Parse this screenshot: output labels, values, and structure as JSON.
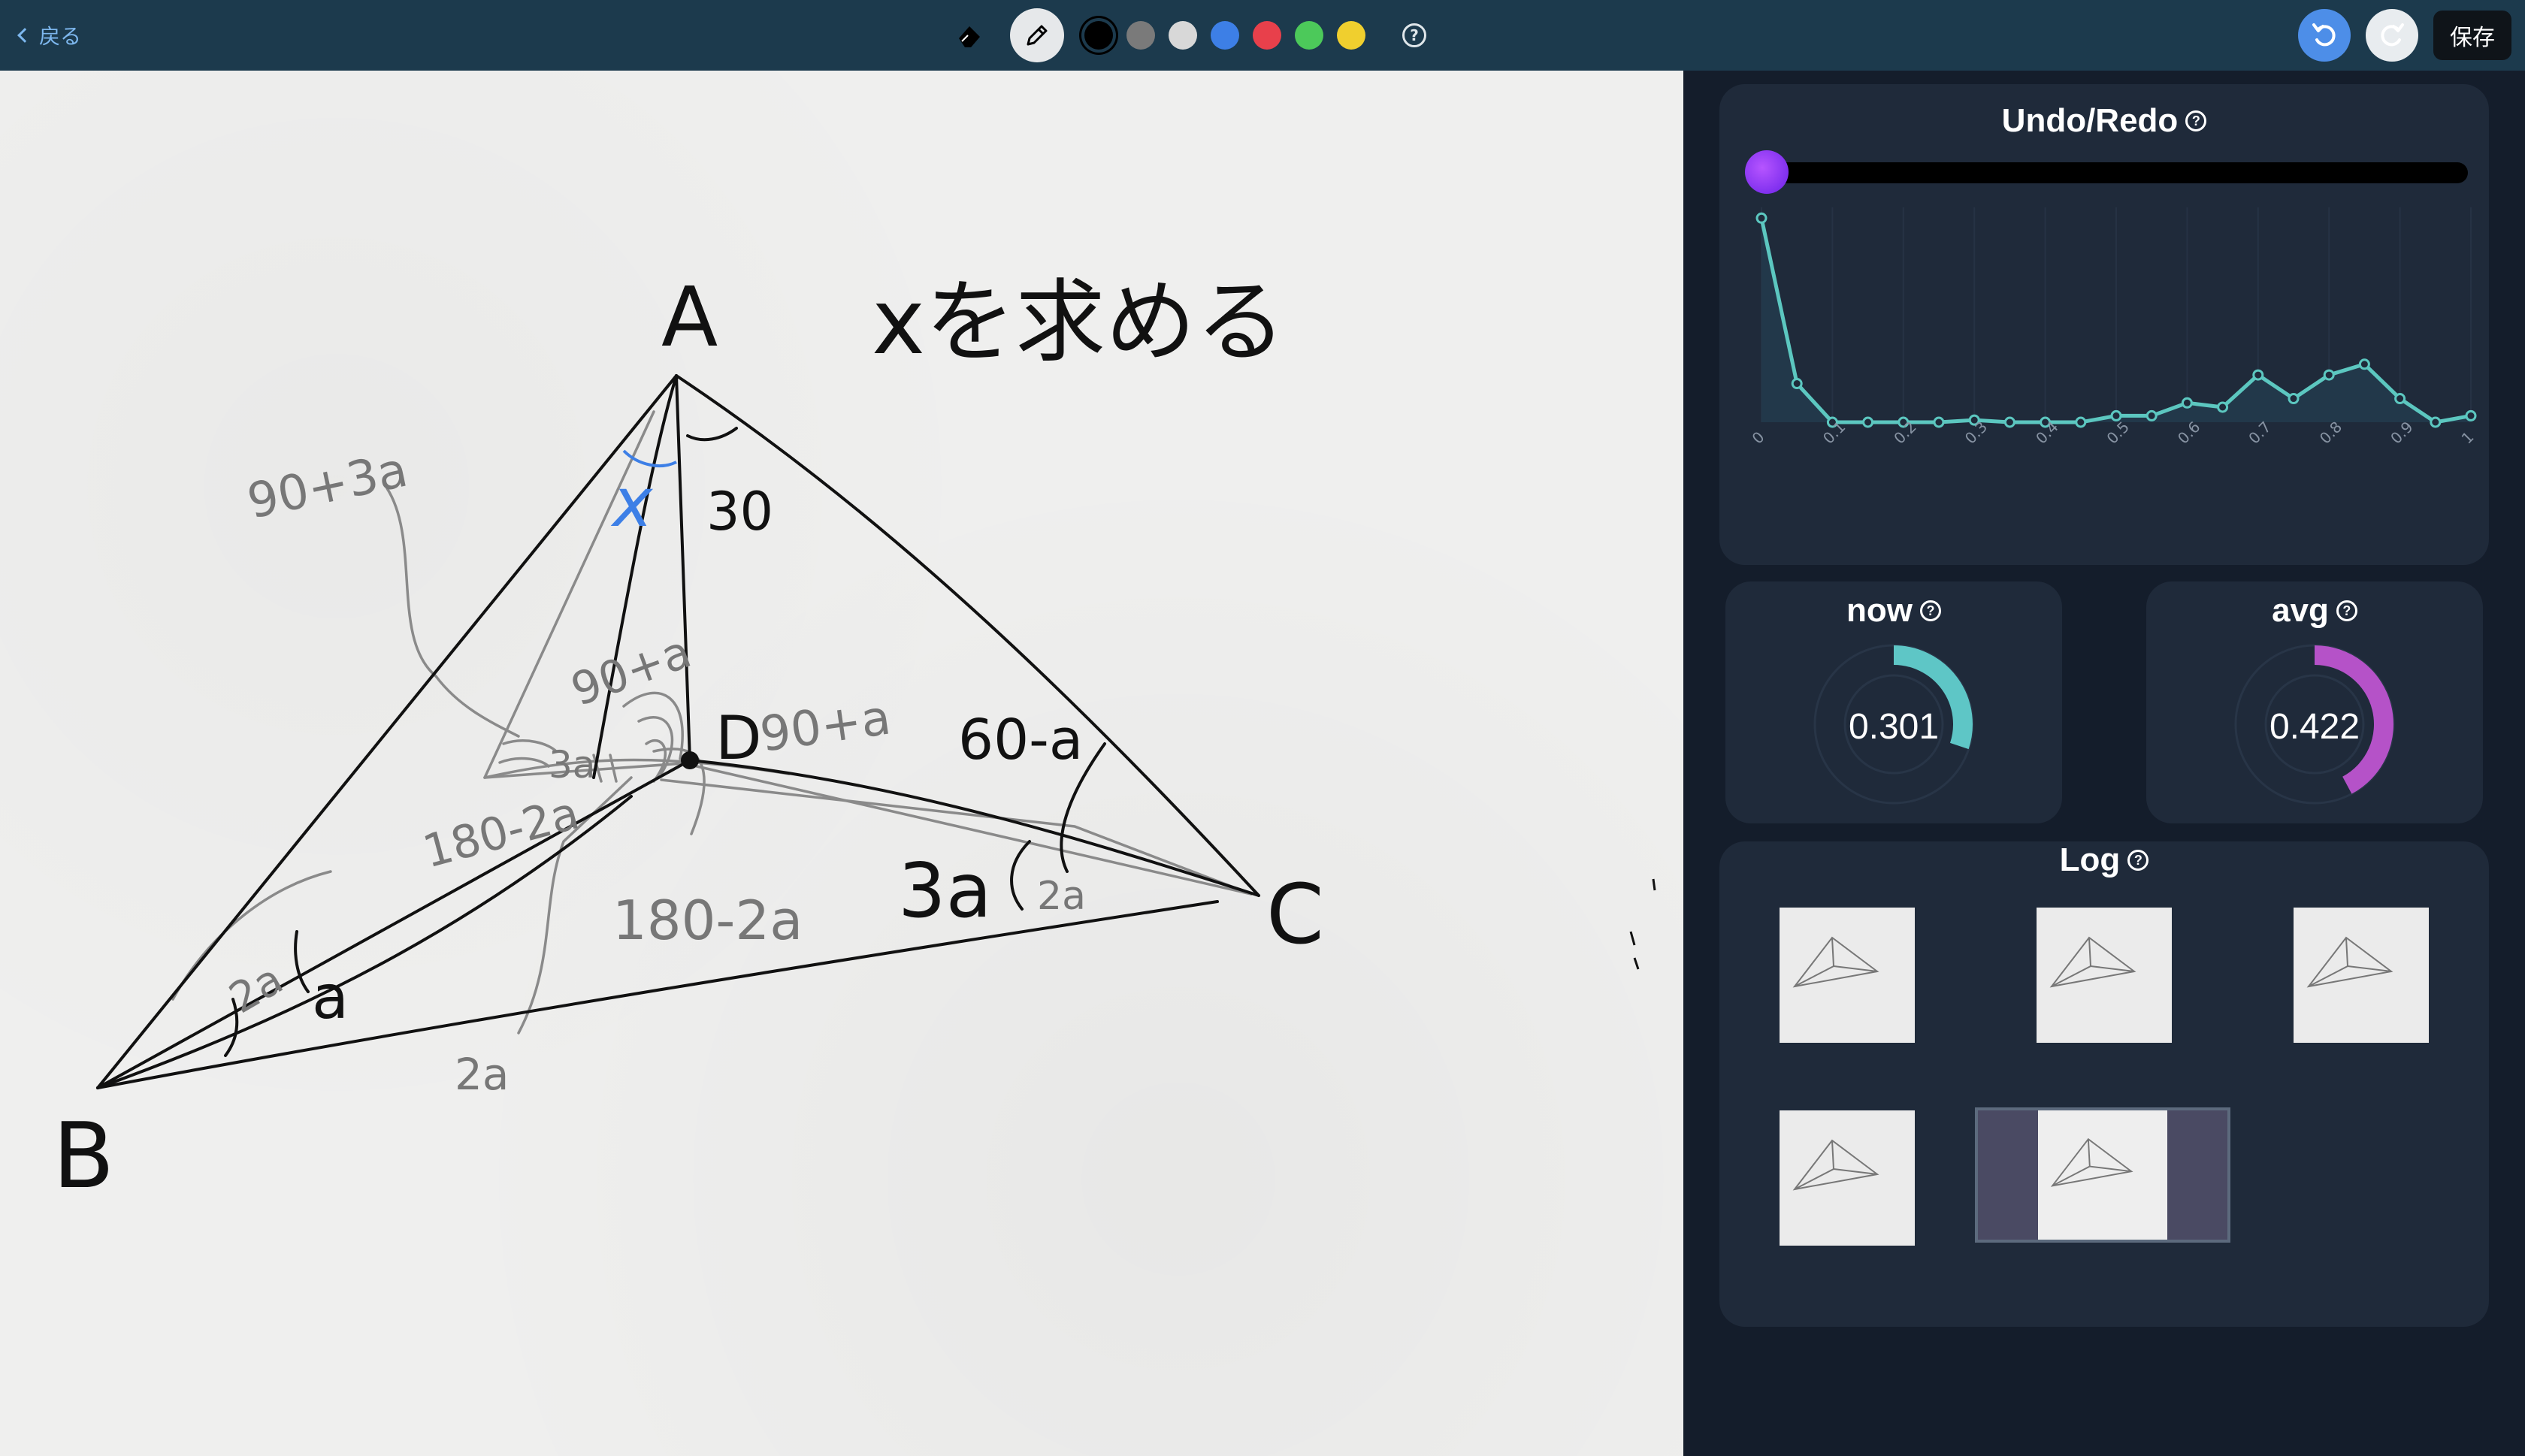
{
  "topbar": {
    "back_label": "戻る",
    "save_label": "保存",
    "colors": [
      "#000000",
      "#7a7a7a",
      "#d8d8d8",
      "#3d7fe6",
      "#e8404b",
      "#4cc95a",
      "#f0cf2e"
    ],
    "selected_color": "#000000"
  },
  "canvas": {
    "text": {
      "vertex_a": "A",
      "vertex_b": "B",
      "vertex_c": "C",
      "vertex_d": "D",
      "heading": "xを求める",
      "x_label": "x",
      "label_30": "30",
      "label_90_3a": "90+3a",
      "label_90_a_top": "90+a",
      "label_90_a_right": "90+a",
      "label_60_a": "60-a",
      "label_3a": "3a",
      "label_2a_c": "2a",
      "label_3a_small": "3a",
      "label_180_2a_left": "180-2a",
      "label_180_2a_bottom": "180-2a",
      "label_2a_b": "2a",
      "label_a_b": "a",
      "label_2a_bottom": "2a"
    }
  },
  "undo_redo": {
    "title": "Undo/Redo",
    "chart_data": {
      "type": "area",
      "x": [
        0,
        0.05,
        0.1,
        0.15,
        0.2,
        0.25,
        0.3,
        0.35,
        0.4,
        0.45,
        0.5,
        0.55,
        0.6,
        0.65,
        0.7,
        0.75,
        0.8,
        0.85,
        0.9,
        0.95,
        1.0
      ],
      "values": [
        0.95,
        0.18,
        0.0,
        0.0,
        0.0,
        0.0,
        0.01,
        0.0,
        0.0,
        0.0,
        0.03,
        0.03,
        0.09,
        0.07,
        0.22,
        0.11,
        0.22,
        0.27,
        0.11,
        0.0,
        0.03
      ],
      "x_ticks": [
        "0",
        "0.1",
        "0.2",
        "0.3",
        "0.4",
        "0.5",
        "0.6",
        "0.7",
        "0.8",
        "0.9",
        "1"
      ],
      "ylim": [
        0,
        1
      ],
      "line_color": "#5cc7c0"
    },
    "slider_position": 0
  },
  "now": {
    "title": "now",
    "value": "0.301",
    "fraction": 0.301,
    "color": "#5ec6c6"
  },
  "avg": {
    "title": "avg",
    "value": "0.422",
    "fraction": 0.422,
    "color": "#b552c8"
  },
  "log": {
    "title": "Log",
    "thumbnails": [
      {
        "id": 1,
        "selected": false
      },
      {
        "id": 2,
        "selected": false
      },
      {
        "id": 3,
        "selected": false
      },
      {
        "id": 4,
        "selected": false
      },
      {
        "id": 5,
        "selected": true
      }
    ]
  }
}
